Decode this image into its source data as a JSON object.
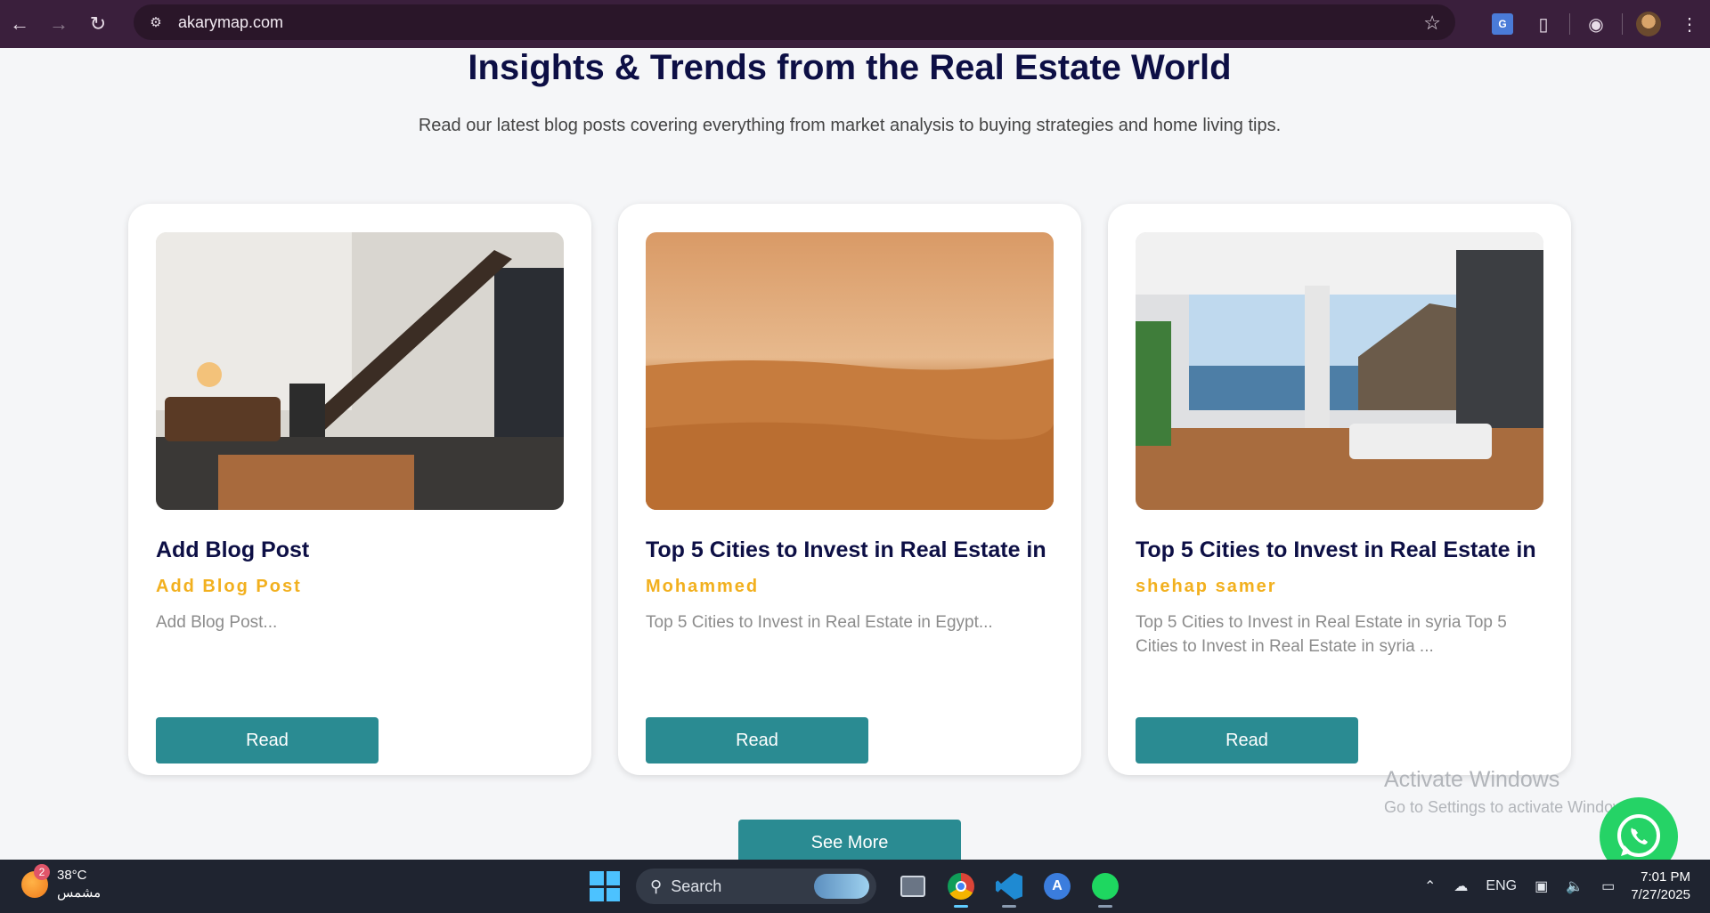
{
  "browser": {
    "url": "akarymap.com"
  },
  "page": {
    "heading": "Insights & Trends from the Real Estate World",
    "subheading": "Read our latest blog posts covering everything from market analysis to buying strategies and home living tips.",
    "cards": [
      {
        "title": "Add Blog Post",
        "author": "Add Blog Post",
        "excerpt": "Add Blog Post...",
        "button": "Read"
      },
      {
        "title": "Top 5 Cities to Invest in Real Estate in",
        "author": "Mohammed",
        "excerpt": "Top 5 Cities to Invest in Real Estate in Egypt...",
        "button": "Read"
      },
      {
        "title": "Top 5 Cities to Invest in Real Estate in",
        "author": "shehap samer",
        "excerpt": "Top 5 Cities to Invest in Real Estate in syria Top 5 Cities to Invest in Real Estate in syria ...",
        "button": "Read"
      }
    ],
    "see_more": "See More"
  },
  "watermark": {
    "line1": "Activate Windows",
    "line2": "Go to Settings to activate Windows."
  },
  "taskbar": {
    "weather_badge": "2",
    "temperature": "38°C",
    "condition": "مشمس",
    "search_label": "Search",
    "language": "ENG",
    "time": "7:01 PM",
    "date": "7/27/2025"
  },
  "colors": {
    "accent": "#2a8b92",
    "heading": "#0d0f45",
    "author": "#f2b01e",
    "browser_chrome": "#3a1f3c"
  }
}
